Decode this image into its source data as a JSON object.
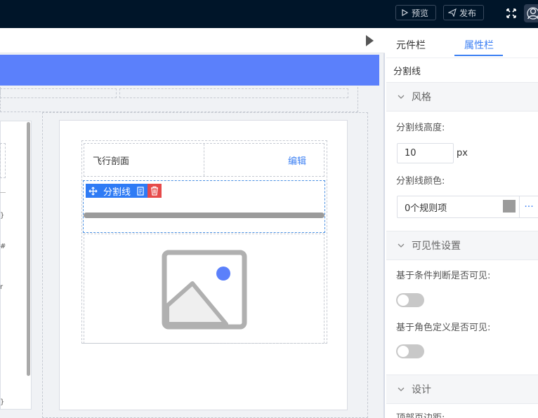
{
  "topbar": {
    "preview_label": "预览",
    "publish_label": "发布"
  },
  "canvas": {
    "row": {
      "title": "飞行剖面",
      "edit_label": "编辑"
    },
    "selection": {
      "component_label": "分割线"
    },
    "left_fragments": [
      "}",
      "#",
      "r",
      "}"
    ],
    "divider_color": "#9b9b9b"
  },
  "rpanel": {
    "tabs": [
      "元件栏",
      "属性栏"
    ],
    "active_tab": "属性栏",
    "component_name": "分割线",
    "sections": {
      "style": "风格",
      "visibility": "可见性设置",
      "design": "设计"
    },
    "height_label": "分割线高度:",
    "height_value": "10",
    "height_unit": "px",
    "color_label": "分割线颜色:",
    "color_rules": "0个规则项",
    "more_label": "···",
    "cond_visible_label": "基于条件判断是否可见:",
    "role_visible_label": "基于角色定义是否可见:",
    "top_margin_label": "顶部页边距:"
  },
  "colors": {
    "topbar": "#001529",
    "accent": "#3b7ff3",
    "header_blue": "#5b80fb",
    "delete_red": "#e64a4a"
  }
}
